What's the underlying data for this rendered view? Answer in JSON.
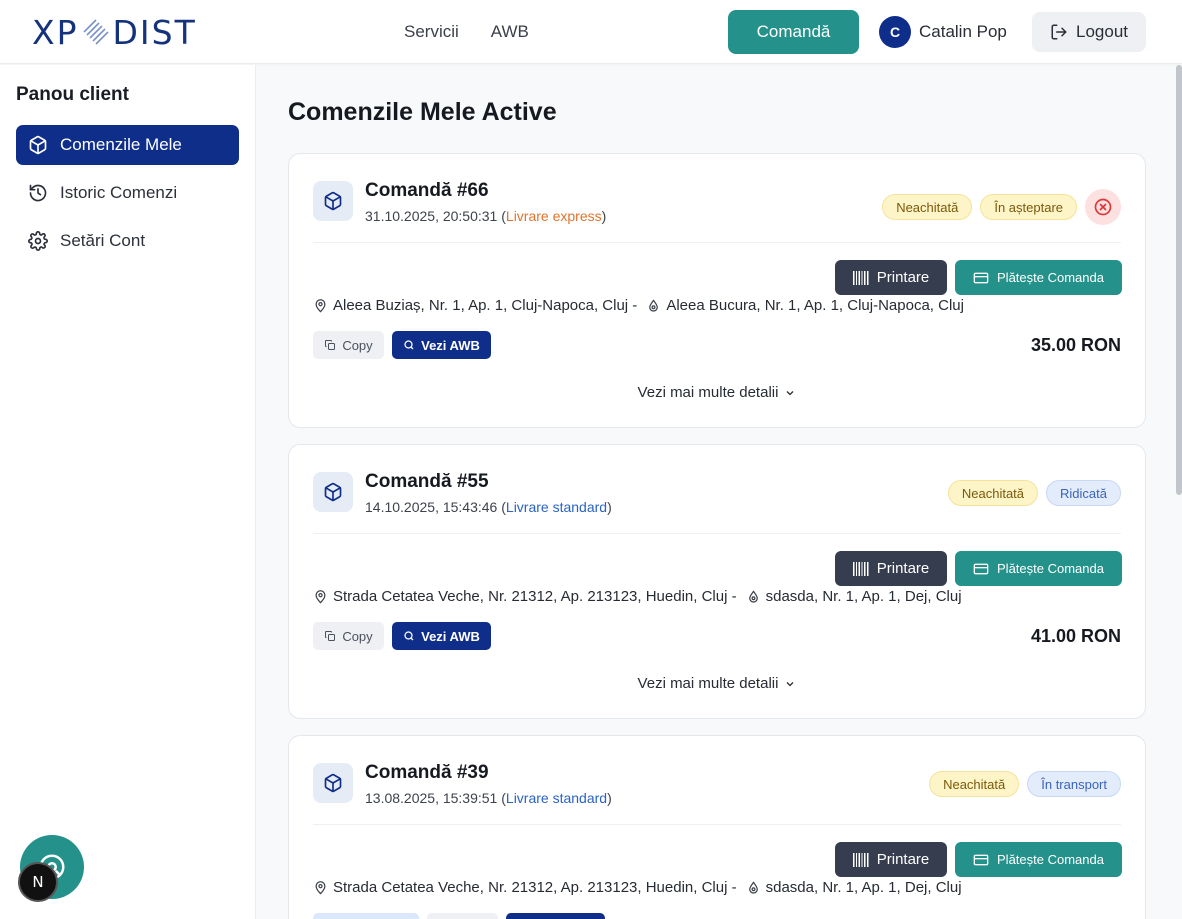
{
  "header": {
    "logo_left": "XP",
    "logo_right": "DIST",
    "nav": [
      "Servicii",
      "AWB"
    ],
    "order_button": "Comandă",
    "user_initial": "C",
    "user_name": "Catalin Pop",
    "logout": "Logout"
  },
  "sidebar": {
    "title": "Panou client",
    "items": [
      {
        "label": "Comenzile Mele",
        "icon": "package-icon",
        "active": true
      },
      {
        "label": "Istoric Comenzi",
        "icon": "history-icon",
        "active": false
      },
      {
        "label": "Setări Cont",
        "icon": "gear-icon",
        "active": false
      }
    ]
  },
  "main": {
    "title": "Comenzile Mele Active",
    "orders": [
      {
        "title": "Comandă #66",
        "date": "31.10.2025, 20:50:31",
        "delivery": "Livrare express",
        "badges": [
          {
            "label": "Neachitată",
            "style": "yellow"
          },
          {
            "label": "În așteptare",
            "style": "yellow"
          }
        ],
        "print_label": "Printare",
        "pay_label": "Plătește Comanda",
        "pickup": "Aleea Buziaș, Nr. 1, Ap. 1, Cluj-Napoca, Cluj -",
        "dropoff": "Aleea Bucura, Nr. 1, Ap. 1, Cluj-Napoca, Cluj",
        "copy_label": "Copy",
        "awb_label": "Vezi AWB",
        "price": "35.00 RON",
        "more_label": "Vezi mai multe detalii"
      },
      {
        "title": "Comandă #55",
        "date": "14.10.2025, 15:43:46",
        "delivery": "Livrare standard",
        "badges": [
          {
            "label": "Neachitată",
            "style": "yellow"
          },
          {
            "label": "Ridicată",
            "style": "blue"
          }
        ],
        "print_label": "Printare",
        "pay_label": "Plătește Comanda",
        "pickup": "Strada Cetatea Veche, Nr. 21312, Ap. 213123, Huedin, Cluj -",
        "dropoff": "sdasda, Nr. 1, Ap. 1, Dej, Cluj",
        "copy_label": "Copy",
        "awb_label": "Vezi AWB",
        "price": "41.00 RON",
        "more_label": "Vezi mai multe detalii"
      },
      {
        "title": "Comandă #39",
        "date": "13.08.2025, 15:39:51",
        "delivery": "Livrare standard",
        "badges": [
          {
            "label": "Neachitată",
            "style": "yellow"
          },
          {
            "label": "În transport",
            "style": "blue"
          }
        ],
        "print_label": "Printare",
        "pay_label": "Plătește Comanda",
        "pickup": "Strada Cetatea Veche, Nr. 21312, Ap. 213123, Huedin, Cluj -",
        "dropoff": "sdasda, Nr. 1, Ap. 1, Dej, Cluj"
      }
    ]
  },
  "floating": {
    "dev_badge": "N"
  },
  "colors": {
    "primary_navy": "#0f2e8a",
    "teal": "#24918a",
    "express_orange": "#e2732a",
    "standard_blue": "#2a63c4"
  }
}
